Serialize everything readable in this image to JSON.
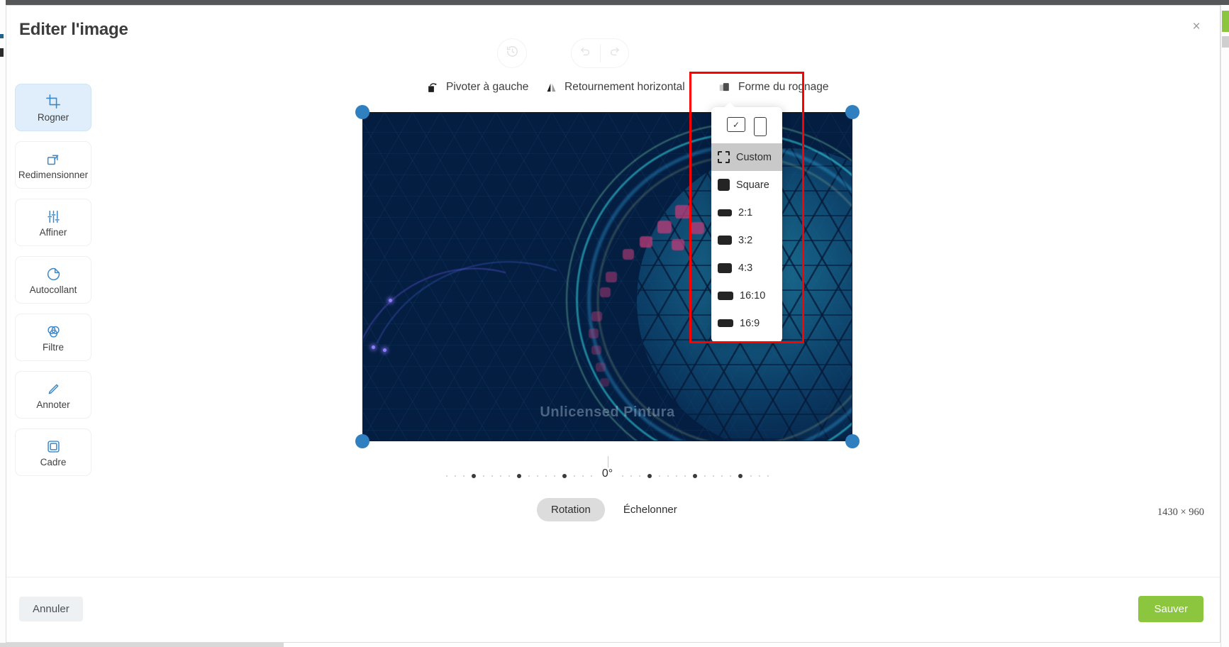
{
  "window": {
    "title": "Editer l'image",
    "close_label": "×"
  },
  "sidebar": {
    "items": [
      {
        "label": "Rogner",
        "icon": "crop-icon",
        "active": true
      },
      {
        "label": "Redimensionner",
        "icon": "resize-icon",
        "active": false
      },
      {
        "label": "Affiner",
        "icon": "sliders-icon",
        "active": false
      },
      {
        "label": "Autocollant",
        "icon": "sticker-icon",
        "active": false
      },
      {
        "label": "Filtre",
        "icon": "filter-icon",
        "active": false
      },
      {
        "label": "Annoter",
        "icon": "pencil-icon",
        "active": false
      },
      {
        "label": "Cadre",
        "icon": "frame-icon",
        "active": false
      }
    ]
  },
  "toolbar": {
    "revert_icon": "history-revert-icon",
    "undo_icon": "undo-icon",
    "redo_icon": "redo-icon",
    "rotate_left": {
      "label": "Pivoter à gauche",
      "icon": "rotate-left-icon"
    },
    "flip_horizontal": {
      "label": "Retournement horizontal",
      "icon": "flip-horizontal-icon"
    },
    "crop_shape": {
      "label": "Forme du rognage",
      "icon": "crop-shape-icon"
    }
  },
  "crop_shape_menu": {
    "orientation": {
      "landscape": {
        "name": "landscape-orientation",
        "selected": true,
        "check": "✓"
      },
      "portrait": {
        "name": "portrait-orientation",
        "selected": false
      }
    },
    "items": [
      {
        "label": "Custom",
        "shape": "shape-custom",
        "selected": true
      },
      {
        "label": "Square",
        "shape": "shape-square",
        "selected": false
      },
      {
        "label": "2:1",
        "shape": "shape-2-1",
        "selected": false
      },
      {
        "label": "3:2",
        "shape": "shape-3-2",
        "selected": false
      },
      {
        "label": "4:3",
        "shape": "shape-4-3",
        "selected": false
      },
      {
        "label": "16:10",
        "shape": "shape-16-10",
        "selected": false
      },
      {
        "label": "16:9",
        "shape": "shape-16-9",
        "selected": false
      }
    ]
  },
  "canvas": {
    "watermark": "Unlicensed Pintura",
    "handle_color": "#3080c0"
  },
  "rotation": {
    "value_label": "0°",
    "value": 0
  },
  "mode_tabs": [
    {
      "label": "Rotation",
      "active": true
    },
    {
      "label": "Échelonner",
      "active": false
    }
  ],
  "status": {
    "dimensions": "1430 × 960"
  },
  "footer": {
    "cancel_label": "Annuler",
    "save_label": "Sauver"
  },
  "colors": {
    "accent_blue": "#3b87c8",
    "save_green": "#8cc63e",
    "highlight_red": "#fe0000",
    "active_sidebar_bg": "#dfeefa"
  }
}
